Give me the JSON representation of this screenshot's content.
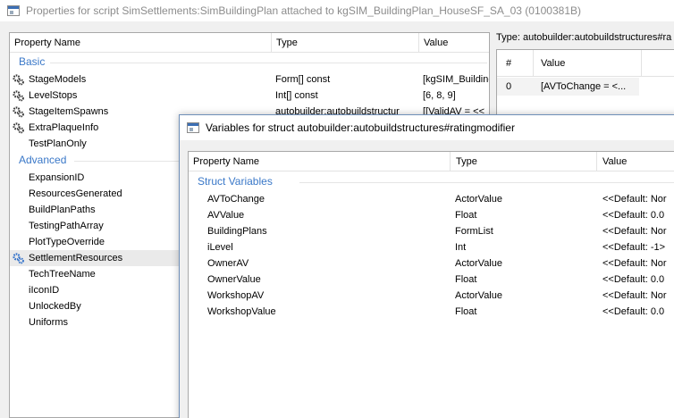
{
  "window": {
    "title": "Properties for script SimSettlements:SimBuildingPlan attached to kgSIM_BuildingPlan_HouseSF_SA_03 (0100381B)"
  },
  "left_table": {
    "columns": [
      "Property Name",
      "Type",
      "Value"
    ],
    "groups": [
      {
        "name": "Basic",
        "rows": [
          {
            "name": "StageModels",
            "type": "Form[] const",
            "value": "[kgSIM_Building",
            "icon": "script-gear-icon"
          },
          {
            "name": "LevelStops",
            "type": "Int[] const",
            "value": "[6, 8, 9]",
            "icon": "script-gear-icon"
          },
          {
            "name": "StageItemSpawns",
            "type": "autobuilder:autobuildstructur",
            "value": "[[ValidAV = <<",
            "icon": "script-gear-icon"
          },
          {
            "name": "ExtraPlaqueInfo",
            "type": "",
            "value": "",
            "icon": "script-gear-icon"
          },
          {
            "name": "TestPlanOnly",
            "type": "",
            "value": "",
            "icon": ""
          }
        ]
      },
      {
        "name": "Advanced",
        "rows": [
          {
            "name": "ExpansionID",
            "type": "",
            "value": "",
            "icon": ""
          },
          {
            "name": "ResourcesGenerated",
            "type": "",
            "value": "",
            "icon": ""
          },
          {
            "name": "BuildPlanPaths",
            "type": "",
            "value": "",
            "icon": ""
          },
          {
            "name": "TestingPathArray",
            "type": "",
            "value": "",
            "icon": ""
          },
          {
            "name": "PlotTypeOverride",
            "type": "",
            "value": "",
            "icon": ""
          },
          {
            "name": "SettlementResources",
            "type": "",
            "value": "",
            "icon": "script-gear-blue-icon"
          },
          {
            "name": "TechTreeName",
            "type": "",
            "value": "",
            "icon": ""
          },
          {
            "name": "iIconID",
            "type": "",
            "value": "",
            "icon": ""
          },
          {
            "name": "UnlockedBy",
            "type": "",
            "value": "",
            "icon": ""
          },
          {
            "name": "Uniforms",
            "type": "",
            "value": "",
            "icon": ""
          }
        ]
      }
    ]
  },
  "right_panel": {
    "type_label": "Type: autobuilder:autobuildstructures#ra",
    "columns": [
      "#",
      "Value"
    ],
    "rows": [
      {
        "index": "0",
        "value": "[AVToChange = <..."
      }
    ]
  },
  "dialog": {
    "title": "Variables for struct autobuilder:autobuildstructures#ratingmodifier",
    "columns": [
      "Property Name",
      "Type",
      "Value"
    ],
    "group": "Struct Variables",
    "rows": [
      {
        "name": "AVToChange",
        "type": "ActorValue",
        "value": "<<Default: Nor"
      },
      {
        "name": "AVValue",
        "type": "Float",
        "value": "<<Default: 0.0"
      },
      {
        "name": "BuildingPlans",
        "type": "FormList",
        "value": "<<Default: Nor"
      },
      {
        "name": "iLevel",
        "type": "Int",
        "value": "<<Default: -1>"
      },
      {
        "name": "OwnerAV",
        "type": "ActorValue",
        "value": "<<Default: Nor"
      },
      {
        "name": "OwnerValue",
        "type": "Float",
        "value": "<<Default: 0.0"
      },
      {
        "name": "WorkshopAV",
        "type": "ActorValue",
        "value": "<<Default: Nor"
      },
      {
        "name": "WorkshopValue",
        "type": "Float",
        "value": "<<Default: 0.0"
      }
    ]
  },
  "colors": {
    "group_header": "#3a78c8",
    "selection": "#eaeaea",
    "icon_dark": "#3c3c3c",
    "icon_blue": "#2f6fc9"
  }
}
